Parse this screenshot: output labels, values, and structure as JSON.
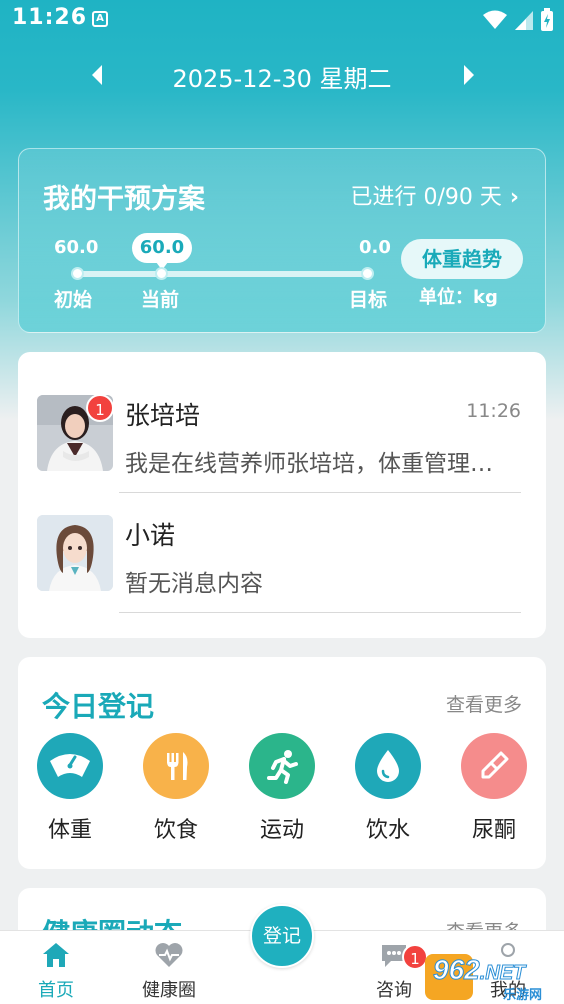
{
  "status_bar": {
    "time": "11:26",
    "notif": "A"
  },
  "date_nav": {
    "date": "2025-12-30 星期二"
  },
  "plan": {
    "title": "我的干预方案",
    "progress": "已进行 0/90 天",
    "initial_value": "60.0",
    "current_value": "60.0",
    "target_value": "0.0",
    "initial_label": "初始",
    "current_label": "当前",
    "target_label": "目标",
    "trend_button": "体重趋势",
    "unit": "单位：kg"
  },
  "chats": [
    {
      "name": "张培培",
      "time": "11:26",
      "message": "我是在线营养师张培培，体重管理师，有什么问题可以问我",
      "badge": "1"
    },
    {
      "name": "小诺",
      "time": "",
      "message": "暂无消息内容"
    }
  ],
  "today": {
    "title": "今日登记",
    "more": "查看更多",
    "items": [
      {
        "label": "体重",
        "icon": "scale-icon",
        "color": "#1fa8b8"
      },
      {
        "label": "饮食",
        "icon": "fork-knife-icon",
        "color": "#f8b24a"
      },
      {
        "label": "运动",
        "icon": "running-icon",
        "color": "#2bb58b"
      },
      {
        "label": "饮水",
        "icon": "water-drop-icon",
        "color": "#1fa8b8"
      },
      {
        "label": "尿酮",
        "icon": "test-strip-icon",
        "color": "#f58c8c"
      }
    ]
  },
  "community": {
    "title": "健康圈动态",
    "more": "查看更多"
  },
  "bottom_nav": {
    "items": [
      {
        "label": "首页",
        "icon": "home-icon",
        "active": true
      },
      {
        "label": "健康圈",
        "icon": "heart-pulse-icon"
      },
      {
        "label": "登记",
        "icon": "register-button"
      },
      {
        "label": "咨询",
        "icon": "chat-icon",
        "badge": "1"
      },
      {
        "label": "我的",
        "icon": "user-icon"
      }
    ]
  },
  "watermark": {
    "text": "962",
    "suffix": ".NET",
    "sub": "乐游网"
  }
}
